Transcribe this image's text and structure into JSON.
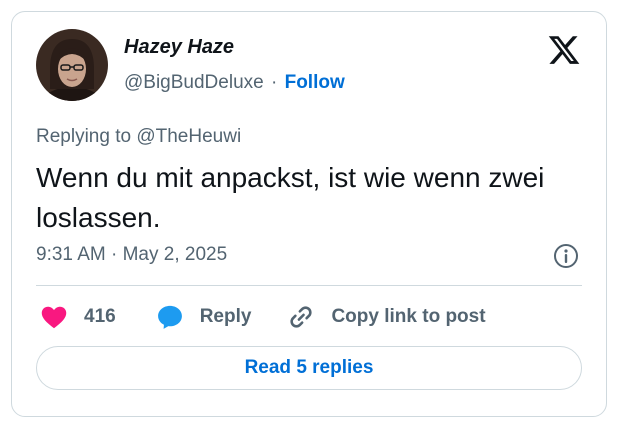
{
  "author": {
    "display_name": "Hazey Haze",
    "handle": "@BigBudDeluxe",
    "separator": "·",
    "follow_label": "Follow"
  },
  "tweet": {
    "replying_to": "Replying to @TheHeuwi",
    "text": "Wenn du mit anpackst, ist wie wenn zwei loslassen.",
    "timestamp": "9:31 AM · May 2, 2025"
  },
  "actions": {
    "like_count": "416",
    "reply_label": "Reply",
    "copy_link_label": "Copy link to post"
  },
  "read_replies_label": "Read 5 replies",
  "icons": {
    "brand": "x-logo-icon",
    "info": "info-icon",
    "like": "heart-icon",
    "reply": "speech-bubble-icon",
    "copy": "link-icon"
  },
  "colors": {
    "link_blue": "#006fd6",
    "heart_pink": "#f91880",
    "reply_blue": "#1d9bf0",
    "text_primary": "#0f1419",
    "text_secondary": "#536471",
    "border": "#cfd9de"
  }
}
